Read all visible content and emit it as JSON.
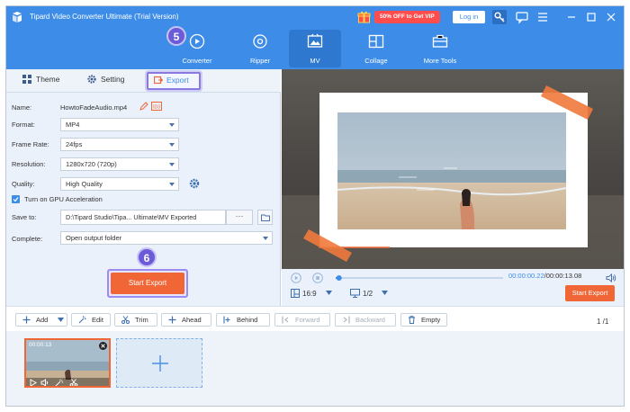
{
  "window": {
    "title": "Tipard Video Converter Ultimate (Trial Version)",
    "vip_badge": "50% OFF to Get VIP",
    "login_label": "Log in"
  },
  "nav": {
    "items": [
      {
        "label": "Converter",
        "icon": "converter-icon",
        "active": false
      },
      {
        "label": "Ripper",
        "icon": "ripper-icon",
        "active": false
      },
      {
        "label": "MV",
        "icon": "mv-icon",
        "active": true
      },
      {
        "label": "Collage",
        "icon": "collage-icon",
        "active": false
      },
      {
        "label": "More Tools",
        "icon": "toolbox-icon",
        "active": false
      }
    ]
  },
  "tabs": {
    "theme": "Theme",
    "setting": "Setting",
    "export": "Export"
  },
  "steps": {
    "step5": "5",
    "step6": "6"
  },
  "export": {
    "name_label": "Name:",
    "name_value": "HowtoFadeAudio.mp4",
    "format_label": "Format:",
    "format_value": "MP4",
    "framerate_label": "Frame Rate:",
    "framerate_value": "24fps",
    "resolution_label": "Resolution:",
    "resolution_value": "1280x720 (720p)",
    "quality_label": "Quality:",
    "quality_value": "High Quality",
    "gpu_label": "Turn on GPU Acceleration",
    "gpu_checked": true,
    "saveto_label": "Save to:",
    "saveto_value": "D:\\Tipard Studio\\Tipa... Ultimate\\MV Exported",
    "browse_label": "···",
    "complete_label": "Complete:",
    "complete_value": "Open output folder",
    "start_export": "Start Export"
  },
  "player": {
    "time_current": "00:00:00.22",
    "time_total": "/00:00:13.08",
    "progress": 0.02,
    "ratio": "16:9",
    "page": "1/2",
    "start_export": "Start Export"
  },
  "toolbar": {
    "add": "Add",
    "edit": "Edit",
    "trim": "Trim",
    "ahead": "Ahead",
    "behind": "Behind",
    "forward": "Forward",
    "backward": "Backward",
    "empty": "Empty",
    "page_counter": "1 /1"
  },
  "timeline": {
    "clip_duration": "00:00:13"
  },
  "colors": {
    "primary": "#3d8de8",
    "accent": "#f06637",
    "highlight": "#8a7ae0"
  }
}
